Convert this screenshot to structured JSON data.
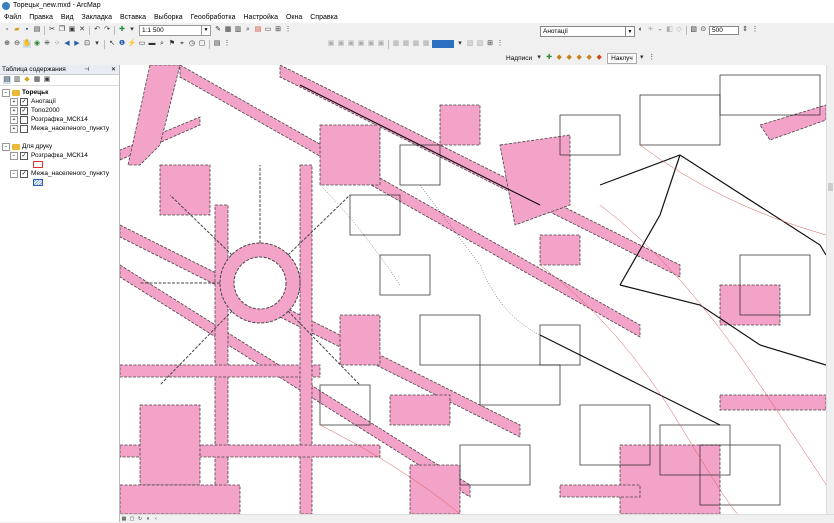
{
  "window": {
    "title": "Торецьк_new.mxd - ArcMap"
  },
  "menu": [
    "Файл",
    "Правка",
    "Вид",
    "Закладка",
    "Вставка",
    "Выборка",
    "Геообработка",
    "Настройка",
    "Окна",
    "Справка"
  ],
  "toolbar": {
    "scale_value": "1:1 500",
    "target_layer": "Анотації",
    "zoom_value": "500"
  },
  "labeling": {
    "label": "Надписи",
    "style_button": "Наклуч"
  },
  "toc": {
    "title": "Таблица содержания",
    "groups": [
      {
        "name": "Торецьк",
        "layers": [
          {
            "name": "Анотації",
            "checked": true
          },
          {
            "name": "Топо2000",
            "checked": true
          },
          {
            "name": "Розграфка_МСК14",
            "checked": false
          },
          {
            "name": "Межа_населеного_пункту",
            "checked": false
          }
        ]
      },
      {
        "name": "Для друку",
        "layers": [
          {
            "name": "Розграфка_МСК14",
            "checked": true
          },
          {
            "name": "Межа_населеного_пункту",
            "checked": true
          }
        ]
      }
    ]
  },
  "colors": {
    "road_fill": "#f4a3c8",
    "road_outline": "#444444",
    "contour": "#d95a5a",
    "map_background": "#ffffff"
  },
  "icons": {
    "app": "arcmap-globe-icon"
  }
}
